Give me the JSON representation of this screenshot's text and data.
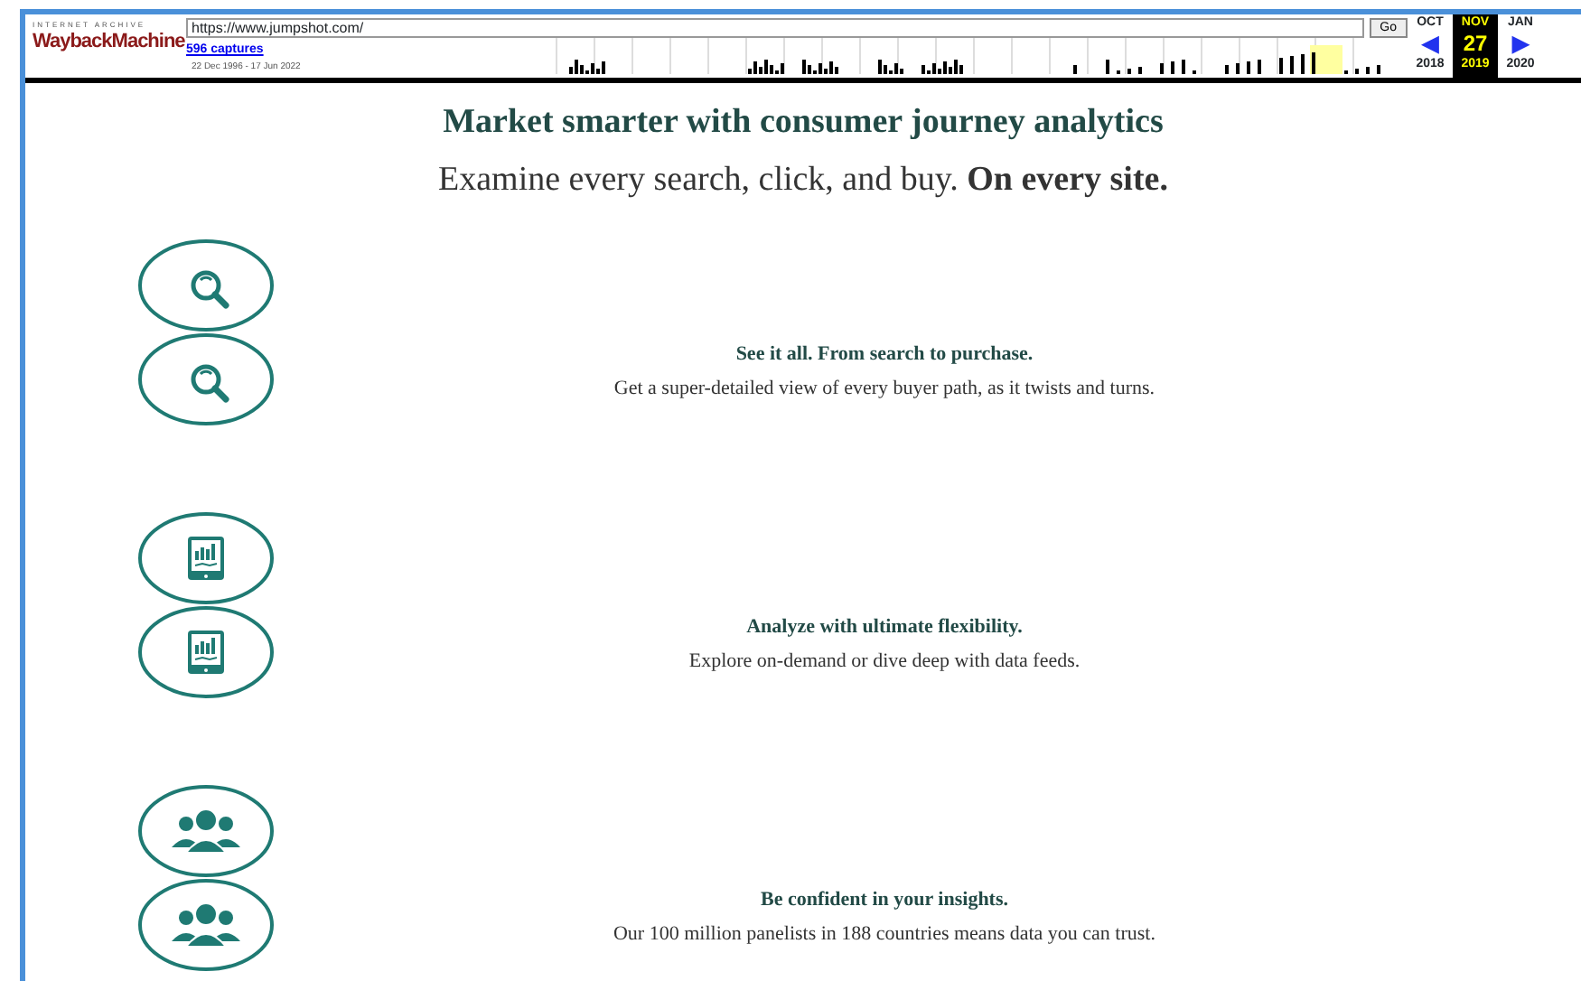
{
  "wayback": {
    "brand_top": "INTERNET ARCHIVE",
    "brand": "WaybackMachine",
    "url": "https://www.jumpshot.com/",
    "go": "Go",
    "captures": "596 captures",
    "range": "22 Dec 1996 - 17 Jun 2022",
    "months": [
      {
        "month": "OCT",
        "day": "◀",
        "year": "2018",
        "selected": false
      },
      {
        "month": "NOV",
        "day": "27",
        "year": "2019",
        "selected": true
      },
      {
        "month": "JAN",
        "day": "▶",
        "year": "2020",
        "selected": false
      }
    ]
  },
  "hero": {
    "title": "Market smarter with consumer journey analytics",
    "subtitle": "Examine every search, click, and buy. **On every site.**"
  },
  "features": [
    {
      "kind": "search",
      "title": "See it all. From search to purchase.",
      "text": "Get a super-detailed view of every buyer path, as it twists and turns."
    },
    {
      "kind": "chart",
      "title": "Analyze with ultimate flexibility.",
      "text": "Explore on-demand or dive deep with data feeds."
    },
    {
      "kind": "people",
      "title": "Be confident in your insights.",
      "text": "Our 100 million panelists in 188 countries means data you can trust."
    }
  ]
}
